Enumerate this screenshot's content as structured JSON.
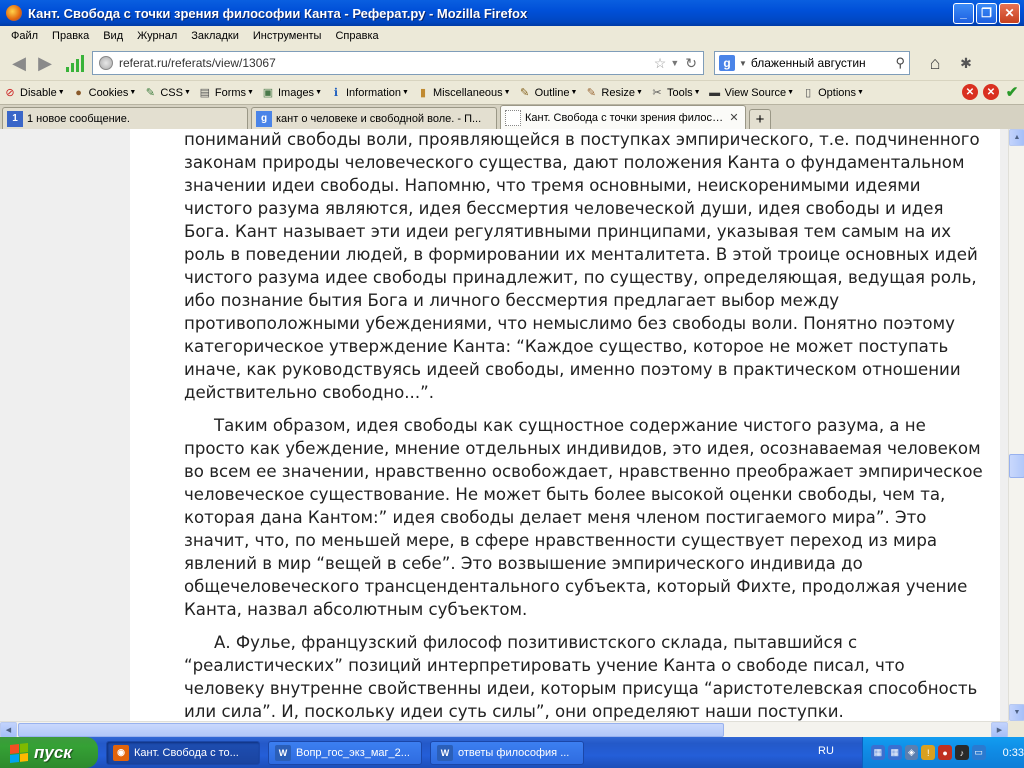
{
  "window": {
    "title": "Кант. Свобода с точки зрения философии Канта - Реферат.ру - Mozilla Firefox",
    "minimize": "_",
    "maximize": "❐",
    "close": "✕"
  },
  "menu": [
    "Файл",
    "Правка",
    "Вид",
    "Журнал",
    "Закладки",
    "Инструменты",
    "Справка"
  ],
  "nav": {
    "back": "◀",
    "forward": "▶",
    "url": "referat.ru/referats/view/13067",
    "search_engine": "g",
    "search_query": "блаженный августин"
  },
  "devtoolbar": [
    {
      "label": "Disable",
      "icon": "⊘",
      "color": "#cc2222"
    },
    {
      "label": "Cookies",
      "icon": "●",
      "color": "#8a5a2a"
    },
    {
      "label": "CSS",
      "icon": "✎",
      "color": "#3a7a3a"
    },
    {
      "label": "Forms",
      "icon": "▤",
      "color": "#555555"
    },
    {
      "label": "Images",
      "icon": "▣",
      "color": "#4a7a4a"
    },
    {
      "label": "Information",
      "icon": "ℹ",
      "color": "#1f5fbf"
    },
    {
      "label": "Miscellaneous",
      "icon": "▮",
      "color": "#c08a30"
    },
    {
      "label": "Outline",
      "icon": "✎",
      "color": "#886622"
    },
    {
      "label": "Resize",
      "icon": "✎",
      "color": "#996633"
    },
    {
      "label": "Tools",
      "icon": "✂",
      "color": "#555555"
    },
    {
      "label": "View Source",
      "icon": "▬",
      "color": "#333333"
    },
    {
      "label": "Options",
      "icon": "▯",
      "color": "#555555"
    }
  ],
  "tabs": [
    {
      "label": "1 новое сообщение.",
      "icon": "1",
      "icon_bg": "#3a66c8",
      "active": false
    },
    {
      "label": "кант о человеке и свободной воле. - П...",
      "icon": "g",
      "icon_bg": "#4a84e8",
      "active": false
    },
    {
      "label": "Кант. Свобода с точки зрения филосо...",
      "icon": "",
      "icon_bg": "#ffffff",
      "active": true
    }
  ],
  "newtab": "+",
  "article": {
    "p1": "пониманий свободы воли, проявляющейся в поступках эмпирического, т.е. подчиненного законам природы человеческого существа, дают положения Канта о фундаментальном значении идеи свободы. Напомню, что тремя основными, неискоренимыми идеями чистого разума являются, идея бессмертия человеческой души, идея свободы и идея Бога. Кант называет эти идеи регулятивными принципами, указывая тем самым на их роль в поведении людей, в формировании их менталитета. В этой троице основных идей чистого разума идее свободы принадлежит, по существу, определяющая, ведущая роль, ибо познание бытия Бога и личного бессмертия предлагает выбор между противоположными убеждениями, что немыслимо без свободы воли. Понятно поэтому категорическое утверждение Канта: “Каждое существо, которое не может поступать иначе, как руководствуясь идеей свободы, именно поэтому в практическом отношении действительно свободно...”.",
    "p2": "Таким образом, идея свободы как сущностное содержание чистого разума, а не просто как убеждение, мнение отдельных индивидов, это идея, осознаваемая человеком во всем ее значении, нравственно освобождает, нравственно преображает эмпирическое человеческое существование. Не может быть более высокой оценки свободы, чем та, которая дана Кантом:” идея свободы делает меня членом постигаемого мира”. Это значит, что, по меньшей мере, в сфере нравственности существует переход из мира явлений в мир “вещей в себе”. Это возвышение эмпирического индивида до общечеловеческого трансцендентального субъекта, который Фихте, продолжая учение Канта, назвал абсолютным субъектом.",
    "p3": "А. Фулье, французский философ позитивистского склада, пытавшийся с “реалистических” позиций интерпретировать учение Канта о свободе писал, что человеку внутренне свойственны идеи, которым присуща “аристотелевская способность или сила”. И, поскольку  идеи суть силы”, они определяют наши поступки. Следовательно, идея свободы, по Фулье, является необходимым условием свободы поведения."
  },
  "scrollbar": {
    "up": "▲",
    "down": "▼",
    "left": "◀",
    "right": "▶"
  },
  "taskbar": {
    "start": "пуск",
    "items": [
      {
        "label": "Кант. Свобода с то...",
        "icon": "◉",
        "icon_bg": "#e2640c",
        "active": true
      },
      {
        "label": "Вопр_гос_экз_маг_2...",
        "icon": "W",
        "icon_bg": "#2b5fb8",
        "active": false
      },
      {
        "label": "ответы философия ...",
        "icon": "W",
        "icon_bg": "#2b5fb8",
        "active": false
      }
    ],
    "lang": "RU",
    "clock": "0:33"
  }
}
